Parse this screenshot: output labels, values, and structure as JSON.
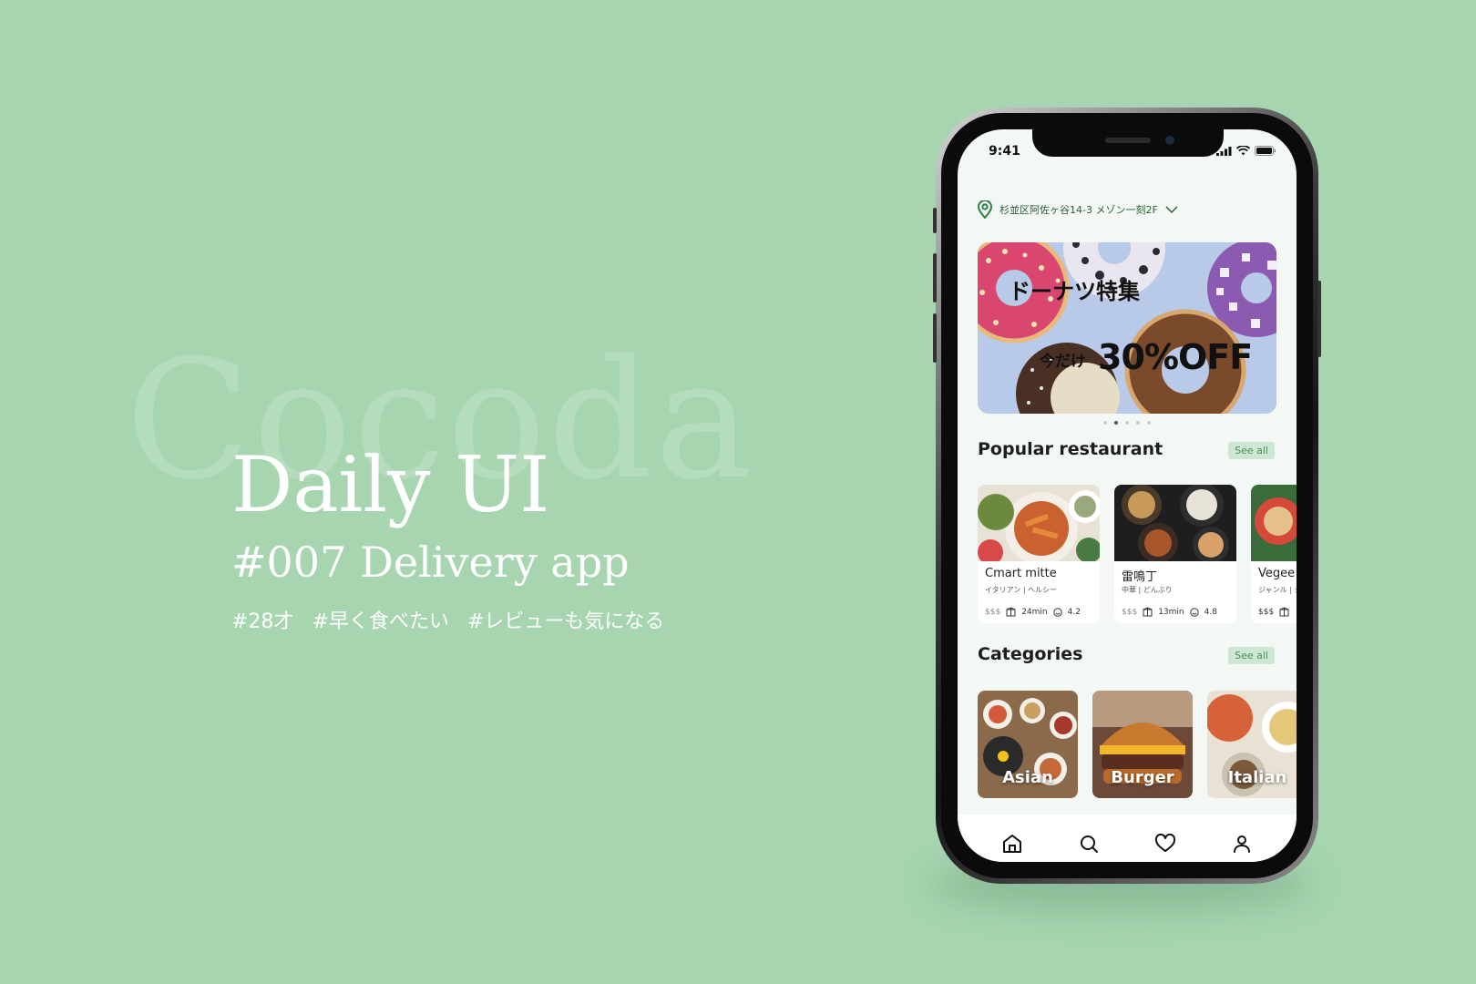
{
  "promo": {
    "watermark": "Cocoda",
    "title": "Daily UI",
    "subtitle": "#007 Delivery app",
    "tags": [
      "#28才",
      "#早く食べたい",
      "#レビューも気になる"
    ]
  },
  "status_bar": {
    "time": "9:41"
  },
  "location": {
    "address": "杉並区阿佐ヶ谷14-3 メゾン一刻2F"
  },
  "banner": {
    "title": "ドーナツ特集",
    "sub": "今だけ",
    "offer": "30%OFF",
    "slide_count": 5,
    "active_slide": 2
  },
  "popular": {
    "title": "Popular restaurant",
    "see_all": "See all",
    "cards": [
      {
        "name": "Cmart mitte",
        "genre": "イタリアン | ヘルシー",
        "price": "$$$",
        "time": "24min",
        "rating": "4.2"
      },
      {
        "name": "雷鳴丁",
        "genre": "中華 | どんぶり",
        "price": "$$$",
        "time": "13min",
        "rating": "4.8"
      },
      {
        "name": "Vegee",
        "genre": "ジャンル | ジ",
        "price": "$$$",
        "time": "",
        "rating": ""
      }
    ]
  },
  "categories": {
    "title": "Categories",
    "see_all": "See all",
    "items": [
      {
        "label": "Asian"
      },
      {
        "label": "Burger"
      },
      {
        "label": "Italian"
      }
    ]
  },
  "nav": {
    "items": [
      "home-icon",
      "search-icon",
      "heart-icon",
      "user-icon"
    ]
  },
  "colors": {
    "background": "#a6d5b0",
    "accent": "#4a8d57",
    "pin": "#2e7d3e"
  }
}
